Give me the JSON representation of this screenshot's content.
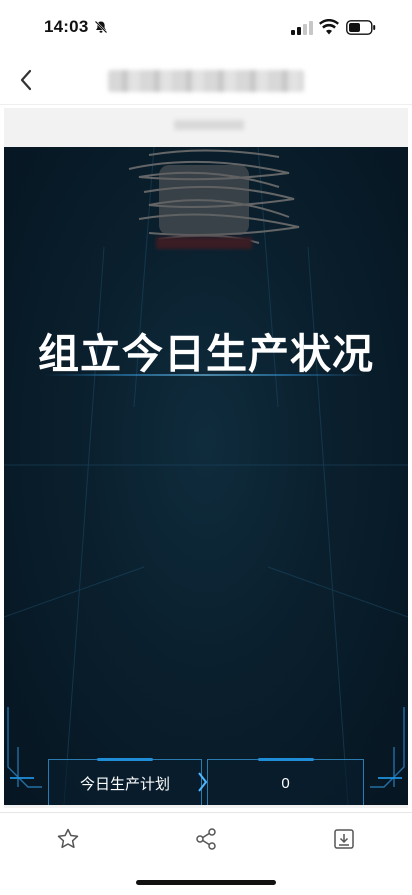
{
  "status_bar": {
    "time": "14:03"
  },
  "dashboard": {
    "title": "组立今日生产状况",
    "plan_label": "今日生产计划",
    "plan_value": "0"
  },
  "icons": {
    "back": "chevron-left-icon",
    "favorite": "star-icon",
    "share": "share-icon",
    "download": "download-icon"
  },
  "colors": {
    "dashboard_bg": "#0a1f2d",
    "accent": "#1f8ed6",
    "title_text": "#ffffff"
  }
}
